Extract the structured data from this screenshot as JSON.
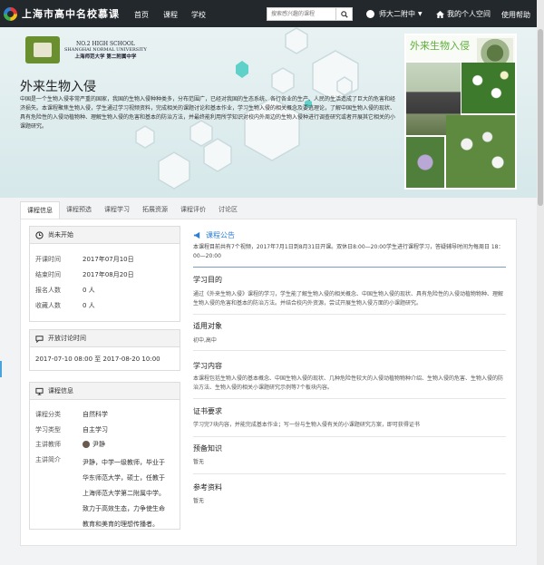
{
  "colors": {
    "nav_bg": "#23282d",
    "accent": "#2f7fd1",
    "banner_bg": "#e1eef0",
    "photo_title": "#5fae3a"
  },
  "nav": {
    "site_name": "上海市高中名校慕课",
    "links": [
      "首页",
      "课程",
      "学校"
    ],
    "search_placeholder": "搜索感兴趣的课程",
    "search_icon": "search-icon",
    "user_name": "师大二附中",
    "home_label": "我的个人空间",
    "help_label": "使用帮助"
  },
  "banner": {
    "school": {
      "line1": "NO.2 HIGH SCHOOL",
      "line2": "SHANGHAI NORMAL UNIVERSITY",
      "line3": "上海师范大学 第二附属中学"
    },
    "course_title": "外来生物入侵",
    "description": "中国是一个生物入侵非常严重的国家，我国的生物入侵种种类多，分布范围广，已经对我国的生态系统、各行各业的生产、人民的生活造成了巨大的危害和经济损失。本课程聚焦生物入侵，学生通过学习视频资料，完成相关的课题讨论和基本作业，学习生物入侵的相关概念及要逃理论，了解中国生物入侵的现状、具有危险性的入侵动植物种、理解生物入侵的危害和基本的防治方法，并最终能利用所学知识对校内外周边的生物入侵种进行调查研究或者开展其它相关的小课题研究。",
    "photo_title": "外来生物入侵"
  },
  "tabs": [
    "课程信息",
    "课程预选",
    "课程学习",
    "拓展资源",
    "课程评价",
    "讨论区"
  ],
  "status_panel": {
    "title": "尚未开始",
    "rows": [
      {
        "label": "开课时间",
        "value": "2017年07月10日"
      },
      {
        "label": "结束时间",
        "value": "2017年08月20日"
      },
      {
        "label": "报名人数",
        "value": "0 人"
      },
      {
        "label": "收藏人数",
        "value": "0 人"
      }
    ]
  },
  "discussion_panel": {
    "title": "开放讨论时间",
    "value": "2017-07-10 08:00 至 2017-08-20 10:00"
  },
  "info_panel": {
    "title": "课程信息",
    "category_label": "课程分类",
    "category": "自然科学",
    "type_label": "学习类型",
    "type": "自主学习",
    "teacher_label": "主讲教师",
    "teacher": "尹静",
    "intro_label": "主讲简介",
    "intro_lines": [
      "尹静，中学一级教师，毕业于",
      "华东师范大学，硕士，任教于",
      "上海师范大学第二附属中学。",
      "致力于高效生态，力争使生命",
      "教育和美育的理想传播者。"
    ]
  },
  "announcement": {
    "title": "课程公告",
    "text": "本课程目前共有7个视频，2017年7月1日到8月31日开课。双休日8:00—20:00学生进行课程学习，答疑辅导时间为每周日 18：00—20:00"
  },
  "sections": [
    {
      "title": "学习目的",
      "text": "通过《外来生物入侵》课程的学习，学生能了解生物入侵的相关概念、中国生物入侵的现状、具有危险性的入侵动植物物种、理解生物入侵的危害和基本的防治方法。并结合校内外资源，尝试开展生物入侵方面的小课题研究。"
    },
    {
      "title": "适用对象",
      "text": "初中,高中"
    },
    {
      "title": "学习内容",
      "text": "本课程包括生物入侵的基本概念、中国生物入侵的现状、几种危险性较大的入侵动植物物种介绍、生物入侵的危害、生物入侵的防治方法、生物入侵的相关小课题研究示例等7个板块内容。"
    },
    {
      "title": "证书要求",
      "text": "学习完7块内容，并能完成基本作业；写一份与生物入侵有关的小课题研究方案，即可获得证书"
    },
    {
      "title": "预备知识",
      "text": "暂无"
    },
    {
      "title": "参考资料",
      "text": "暂无"
    }
  ]
}
